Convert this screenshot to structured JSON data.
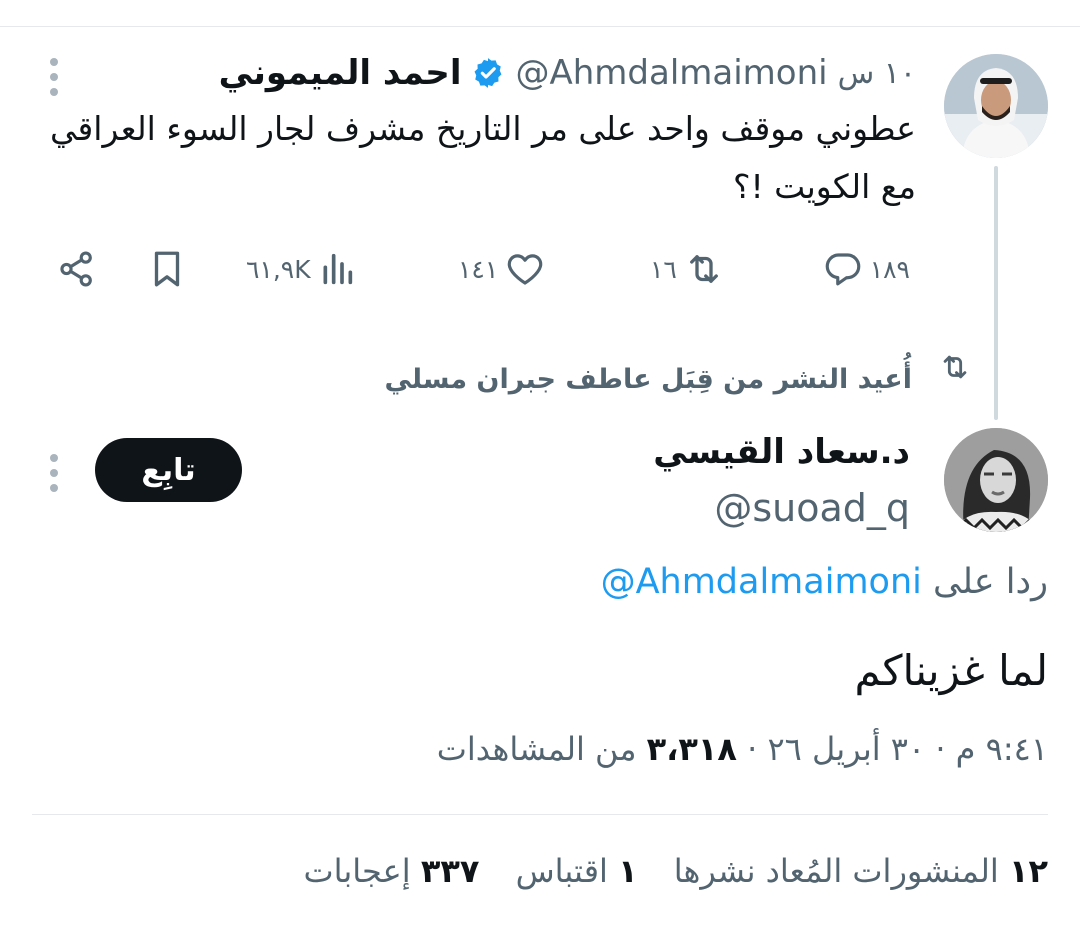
{
  "tweet1": {
    "author_name": "احمد الميموني",
    "handle": "@Ahmdalmaimoni",
    "time": "١٠ س",
    "text": "عطوني موقف واحد على مر التاريخ مشرف لجار السوء العراقي مع الكويت !؟",
    "replies": "١٨٩",
    "reposts": "١٦",
    "likes": "١٤١",
    "views": "٦١,٩K"
  },
  "repost_notice": "أُعيد النشر من قِبَل عاطف جبران مسلي",
  "tweet2": {
    "author_name": "د.سعاد القيسي",
    "handle": "@suoad_q",
    "follow_label": "تابِع",
    "reply_prefix": "ردا على",
    "reply_mention": "@Ahmdalmaimoni",
    "text": "لما غزيناكم",
    "timestamp": "٩:٤١ م · ٣٠ أبريل ٢٦ ·",
    "views_count": "٣،٣١٨",
    "views_label": "من المشاهدات",
    "reposts_count": "١٢",
    "reposts_label": "المنشورات المُعاد نشرها",
    "quotes_count": "١",
    "quotes_label": "اقتباس",
    "likes_count": "٣٣٧",
    "likes_label": "إعجابات"
  },
  "colors": {
    "text": "#0f1419",
    "secondary": "#536471",
    "link": "#1d9bf0",
    "verified": "#1d9bf0",
    "button": "#0f1419"
  }
}
